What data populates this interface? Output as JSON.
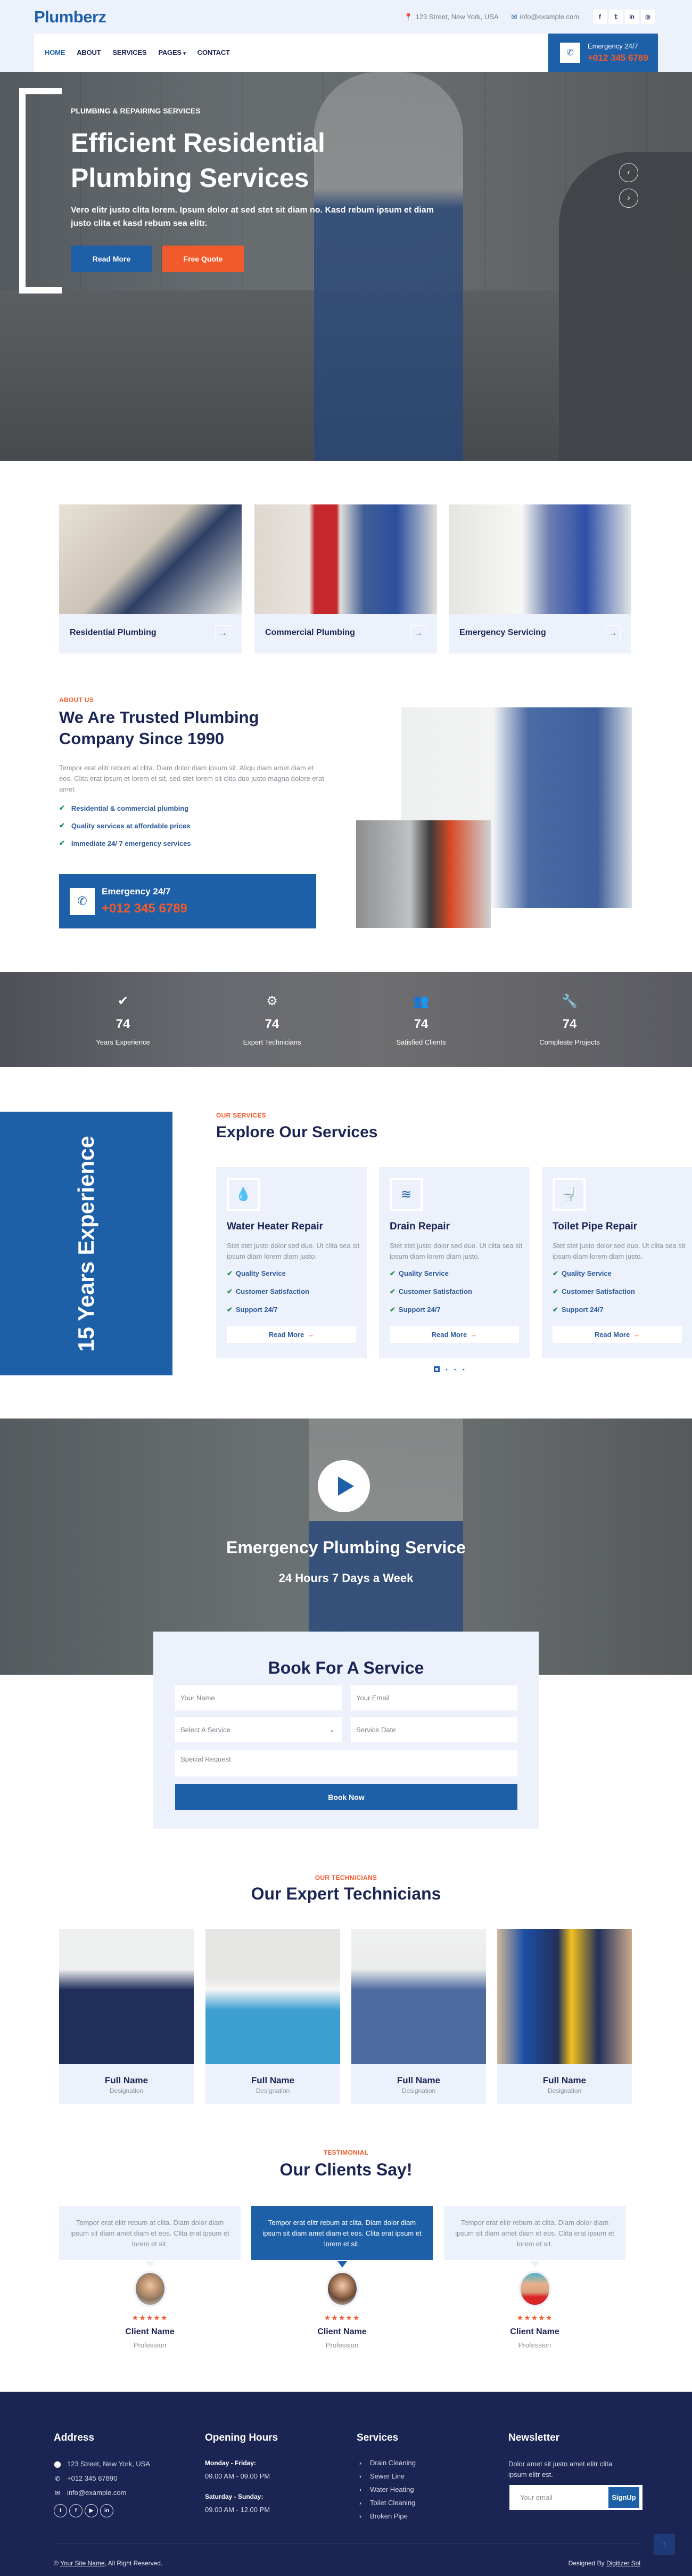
{
  "brand": "Plumberz",
  "topbar": {
    "address": "123 Street, New York, USA",
    "email": "info@example.com",
    "social": [
      "f",
      "t",
      "in",
      "ig"
    ]
  },
  "nav": {
    "items": [
      "HOME",
      "ABOUT",
      "SERVICES",
      "PAGES",
      "CONTACT"
    ],
    "active": "HOME",
    "emergency_label": "Emergency 24/7",
    "emergency_phone": "+012 345 6789"
  },
  "hero": {
    "subtitle": "PLUMBING & REPAIRING SERVICES",
    "title": "Efficient Residential Plumbing Services",
    "text": "Vero elitr justo clita lorem. Ipsum dolor at sed stet sit diam no. Kasd rebum ipsum et diam justo clita et kasd rebum sea elitr.",
    "btn_primary": "Read More",
    "btn_secondary": "Free Quote",
    "prev": "‹",
    "next": "›"
  },
  "features": [
    {
      "label": "Residential Plumbing",
      "arrow": "→"
    },
    {
      "label": "Commercial Plumbing",
      "arrow": "→"
    },
    {
      "label": "Emergency Servicing",
      "arrow": "→"
    }
  ],
  "about": {
    "eyebrow": "ABOUT US",
    "title": "We Are Trusted Plumbing Company Since 1990",
    "text": "Tempor erat elitr rebum at clita. Diam dolor diam ipsum sit. Aliqu diam amet diam et eos. Clita erat ipsum et lorem et sit, sed stet lorem sit clita duo justo magna dolore erat amet",
    "checks": [
      "Residential & commercial plumbing",
      "Quality services at affordable prices",
      "Immediate 24/ 7 emergency services"
    ],
    "emergency_label": "Emergency 24/7",
    "emergency_phone": "+012 345 6789"
  },
  "stats": [
    {
      "icon": "✔",
      "value": "74",
      "label": "Years Experience"
    },
    {
      "icon": "⚙",
      "value": "74",
      "label": "Expert Technicians"
    },
    {
      "icon": "👥",
      "value": "74",
      "label": "Satisfied Clients"
    },
    {
      "icon": "🔧",
      "value": "74",
      "label": "Compleate Projects"
    }
  ],
  "services": {
    "experience": "15 Years Experience",
    "eyebrow": "OUR SERVICES",
    "title": "Explore Our Services",
    "cards": [
      {
        "icon": "💧",
        "title": "Water Heater Repair",
        "text": "Stet stet justo dolor sed duo. Ut clita sea sit ipsum diam lorem diam justo.",
        "features": [
          "Quality Service",
          "Customer Satisfaction",
          "Support 24/7"
        ],
        "cta": "Read More"
      },
      {
        "icon": "≋",
        "title": "Drain Repair",
        "text": "Stet stet justo dolor sed duo. Ut clita sea sit ipsum diam lorem diam justo.",
        "features": [
          "Quality Service",
          "Customer Satisfaction",
          "Support 24/7"
        ],
        "cta": "Read More"
      },
      {
        "icon": "🚽",
        "title": "Toilet Pipe Repair",
        "text": "Stet stet justo dolor sed duo. Ut clita sea sit ipsum diam lorem diam justo.",
        "features": [
          "Quality Service",
          "Customer Satisfaction",
          "Support 24/7"
        ],
        "cta": "Read More"
      }
    ],
    "carousel_pages": 4,
    "carousel_active": 1
  },
  "video": {
    "title": "Emergency Plumbing Service",
    "subtitle": "24 Hours 7 Days a Week"
  },
  "booking": {
    "title": "Book For A Service",
    "name_placeholder": "Your Name",
    "email_placeholder": "Your Email",
    "service_placeholder": "Select A Service",
    "date_placeholder": "Service Date",
    "request_placeholder": "Special Request",
    "submit": "Book Now"
  },
  "team": {
    "eyebrow": "OUR TECHNICIANS",
    "title": "Our Expert Technicians",
    "members": [
      {
        "name": "Full Name",
        "designation": "Designation"
      },
      {
        "name": "Full Name",
        "designation": "Designation"
      },
      {
        "name": "Full Name",
        "designation": "Designation"
      },
      {
        "name": "Full Name",
        "designation": "Designation"
      }
    ]
  },
  "testimonials": {
    "eyebrow": "TESTIMONIAL",
    "title": "Our Clients Say!",
    "items": [
      {
        "text": "Tempor erat elitr rebum at clita. Diam dolor diam ipsum sit diam amet diam et eos. Clita erat ipsum et lorem et sit.",
        "name": "Client Name",
        "profession": "Profession",
        "rating": 5
      },
      {
        "text": "Tempor erat elitr rebum at clita. Diam dolor diam ipsum sit diam amet diam et eos. Clita erat ipsum et lorem et sit.",
        "name": "Client Name",
        "profession": "Profession",
        "rating": 5
      },
      {
        "text": "Tempor erat elitr rebum at clita. Diam dolor diam ipsum sit diam amet diam et eos. Clita erat ipsum et lorem et sit.",
        "name": "Client Name",
        "profession": "Profession",
        "rating": 5
      }
    ],
    "active_index": 1
  },
  "footer": {
    "address_title": "Address",
    "address": "123 Street, New York, USA",
    "phone": "+012 345 67890",
    "email": "info@example.com",
    "hours_title": "Opening Hours",
    "weekday_label": "Monday - Friday:",
    "weekday_hours": "09.00 AM - 09.00 PM",
    "weekend_label": "Saturday - Sunday:",
    "weekend_hours": "09.00 AM - 12.00 PM",
    "services_title": "Services",
    "services": [
      "Drain Cleaning",
      "Sewer Line",
      "Water Heating",
      "Toilet Cleaning",
      "Broken Pipe"
    ],
    "newsletter_title": "Newsletter",
    "newsletter_text": "Dolor amet sit justo amet elitr clita ipsum elitr est.",
    "newsletter_placeholder": "Your email",
    "newsletter_button": "SignUp",
    "copyright_prefix": "©",
    "site_name": "Your Site Name",
    "copyright_suffix": ", All Right Reserved.",
    "designed_by": "Designed By",
    "designer": "Digitizer Sol",
    "social": [
      "t",
      "f",
      "yt",
      "in"
    ]
  },
  "colors": {
    "primary": "#1e60a8",
    "accent": "#f15a2b",
    "dark": "#1b2554",
    "light": "#edf1fc"
  }
}
